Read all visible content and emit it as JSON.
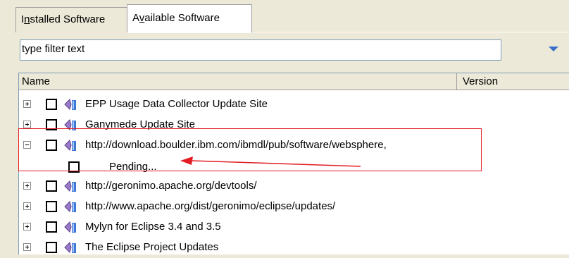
{
  "tabs": [
    {
      "label_pre": "I",
      "label_u": "n",
      "label_post": "stalled Software"
    },
    {
      "label_pre": "A",
      "label_u": "v",
      "label_post": "ailable Software"
    }
  ],
  "filter": {
    "placeholder": "type filter text"
  },
  "table": {
    "columns": {
      "name": "Name",
      "version": "Version"
    },
    "rows": [
      {
        "label": "EPP Usage Data Collector Update Site"
      },
      {
        "label": "Ganymede Update Site"
      },
      {
        "label": "http://download.boulder.ibm.com/ibmdl/pub/software/websphere,"
      },
      {
        "label": "Pending..."
      },
      {
        "label": "http://geronimo.apache.org/devtools/"
      },
      {
        "label": "http://www.apache.org/dist/geronimo/eclipse/updates/"
      },
      {
        "label": "Mylyn for Eclipse 3.4 and 3.5"
      },
      {
        "label": "The Eclipse Project Updates"
      }
    ]
  },
  "colors": {
    "highlight": "#e31c23",
    "accent": "#3a6ec8"
  }
}
